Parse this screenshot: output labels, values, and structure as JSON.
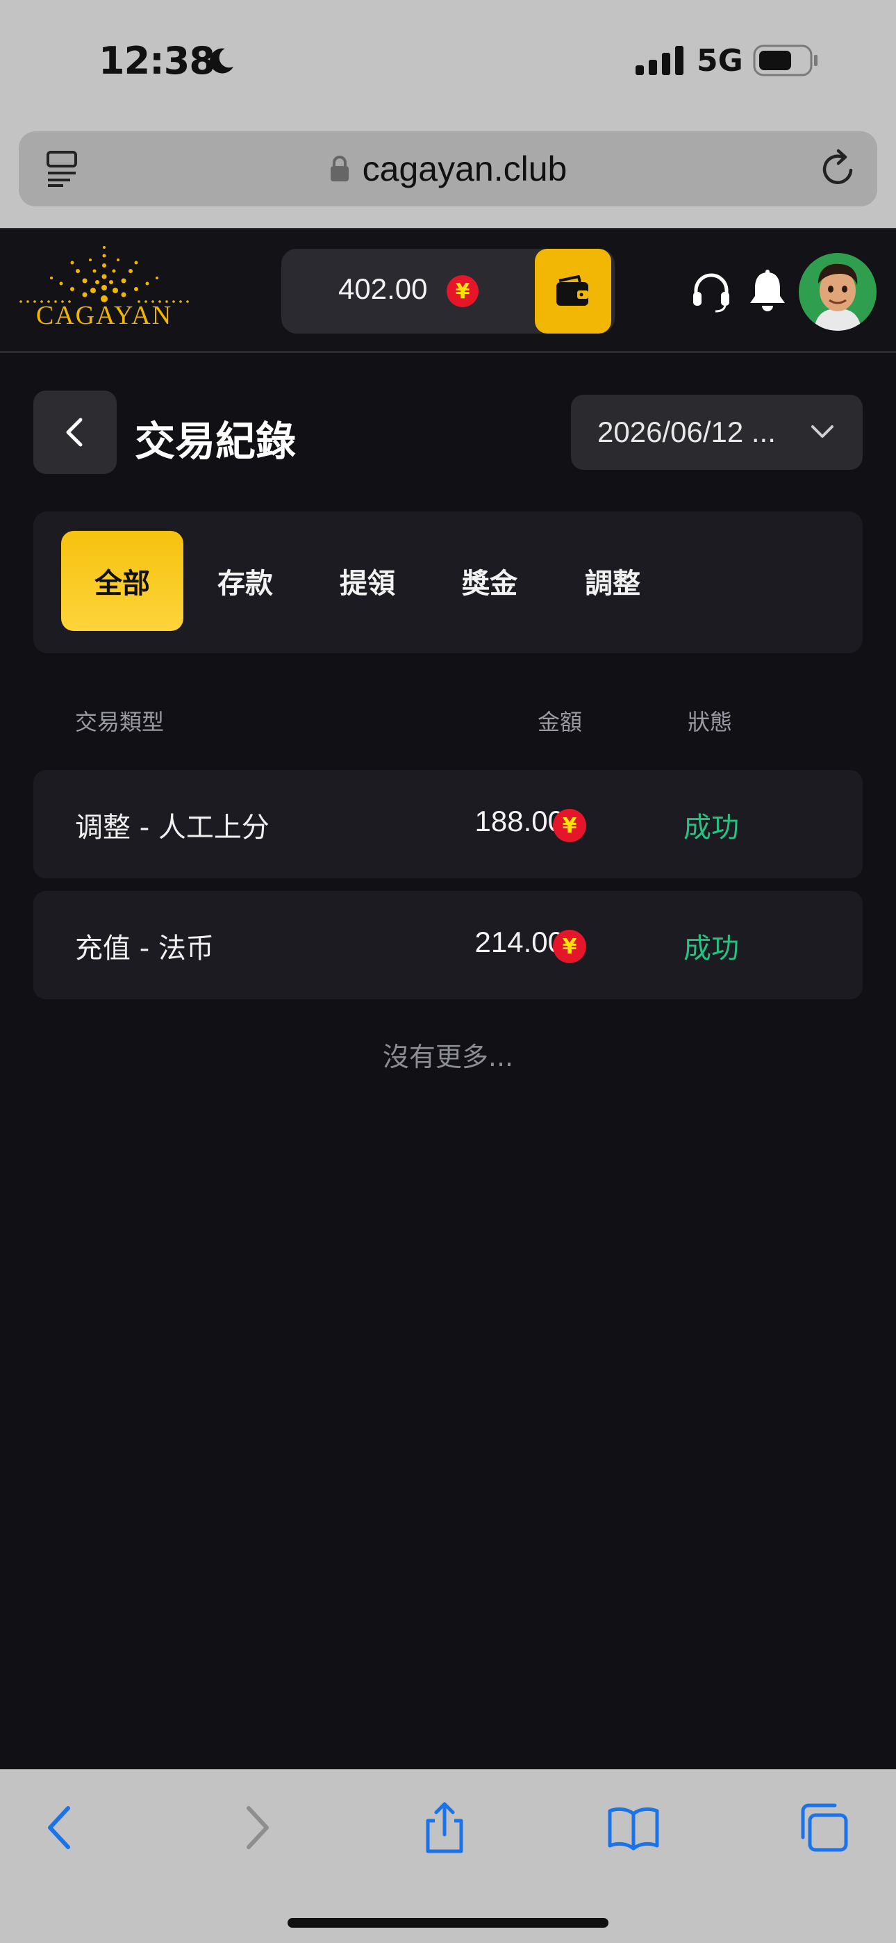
{
  "status_bar": {
    "time": "12:38",
    "network": "5G"
  },
  "browser": {
    "url": "cagayan.club"
  },
  "header": {
    "logo_text": "CAGAYAN",
    "balance": "402.00",
    "currency_symbol": "¥"
  },
  "page": {
    "title": "交易紀錄",
    "date_filter": "2026/06/12 ..."
  },
  "tabs": [
    {
      "label": "全部",
      "active": true
    },
    {
      "label": "存款",
      "active": false
    },
    {
      "label": "提領",
      "active": false
    },
    {
      "label": "獎金",
      "active": false
    },
    {
      "label": "調整",
      "active": false
    }
  ],
  "table": {
    "headers": {
      "type": "交易類型",
      "amount": "金額",
      "status": "狀態"
    },
    "rows": [
      {
        "type": "调整 - 人工上分",
        "amount": "188.00",
        "currency_symbol": "¥",
        "status": "成功"
      },
      {
        "type": "充值 - 法币",
        "amount": "214.00",
        "currency_symbol": "¥",
        "status": "成功"
      }
    ]
  },
  "footer_note": "沒有更多...",
  "colors": {
    "accent": "#f2b705",
    "success": "#26c281",
    "currency_badge": "#e5162a",
    "background": "#101015"
  }
}
